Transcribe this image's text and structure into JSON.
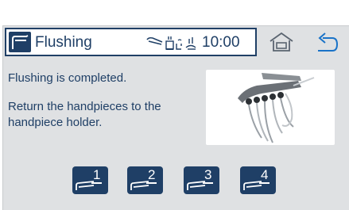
{
  "header": {
    "title": "Flushing",
    "time": "10:00",
    "status_icons": [
      "handpiece-icon",
      "cup-filler-icon",
      "spittoon-icon",
      "flush-icon"
    ]
  },
  "nav": {
    "home_icon": "home-icon",
    "back_icon": "back-arrow-icon"
  },
  "content": {
    "message_completed": "Flushing is completed.",
    "message_instruction": "Return the handpieces to the handpiece holder.",
    "image": "handpieces-in-holder-photo"
  },
  "handpieces": [
    {
      "number": "1"
    },
    {
      "number": "2"
    },
    {
      "number": "3"
    },
    {
      "number": "4"
    }
  ],
  "colors": {
    "primary": "#1f3f66",
    "background": "#dfe1e3",
    "accent_back": "#1a73c8"
  }
}
